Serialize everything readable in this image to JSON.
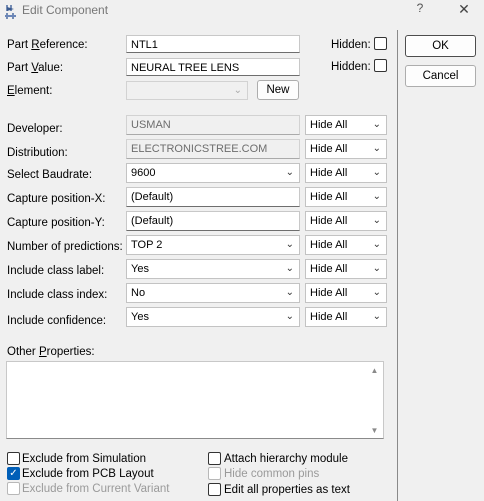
{
  "window": {
    "title": "Edit Component",
    "help_glyph": "?",
    "close_glyph": "✕"
  },
  "part_reference": {
    "label_pre": "Part ",
    "label_u": "R",
    "label_post": "eference:",
    "value": "NTL1",
    "hidden_label": "Hidden:",
    "hidden_checked": false
  },
  "part_value": {
    "label_pre": "Part ",
    "label_u": "V",
    "label_post": "alue:",
    "value": "NEURAL TREE LENS",
    "hidden_label": "Hidden:",
    "hidden_checked": false
  },
  "element": {
    "label_u": "E",
    "label_post": "lement:",
    "value": "",
    "new_button": "New"
  },
  "properties": [
    {
      "label": "Developer:",
      "value": "USMAN",
      "kind": "text-disabled",
      "visibility": "Hide All"
    },
    {
      "label": "Distribution:",
      "value": "ELECTRONICSTREE.COM",
      "kind": "text-disabled",
      "visibility": "Hide All"
    },
    {
      "label": "Select Baudrate:",
      "value": "9600",
      "kind": "combo",
      "visibility": "Hide All"
    },
    {
      "label": "Capture position-X:",
      "value": "(Default)",
      "kind": "text",
      "visibility": "Hide All"
    },
    {
      "label": "Capture position-Y:",
      "value": "(Default)",
      "kind": "text",
      "visibility": "Hide All"
    },
    {
      "label": "Number of predictions:",
      "value": "TOP 2",
      "kind": "combo",
      "visibility": "Hide All"
    },
    {
      "label": "Include class label:",
      "value": "Yes",
      "kind": "combo",
      "visibility": "Hide All"
    },
    {
      "label": "Include class index:",
      "value": "No",
      "kind": "combo",
      "visibility": "Hide All"
    },
    {
      "label": "Include confidence:",
      "value": "Yes",
      "kind": "combo",
      "visibility": "Hide All"
    }
  ],
  "other_properties": {
    "label_pre": "Other ",
    "label_u": "P",
    "label_post": "roperties:",
    "text": ""
  },
  "options": {
    "exclude_simulation": {
      "label": "Exclude from Simulation",
      "checked": false,
      "enabled": true
    },
    "exclude_pcb": {
      "label": "Exclude from PCB Layout",
      "checked": true,
      "enabled": true
    },
    "exclude_variant": {
      "label": "Exclude from Current Variant",
      "checked": false,
      "enabled": false
    },
    "attach_hierarchy": {
      "label": "Attach hierarchy module",
      "checked": false,
      "enabled": true
    },
    "hide_common_pins": {
      "label": "Hide common pins",
      "checked": false,
      "enabled": false
    },
    "edit_all_text": {
      "label": "Edit all properties as text",
      "checked": false,
      "enabled": true
    }
  },
  "buttons": {
    "ok": "OK",
    "cancel": "Cancel"
  },
  "colors": {
    "accent": "#005fb8",
    "background": "#f0f0f0",
    "disabled_text": "#6d6d6d"
  },
  "icons": {
    "combo_arrow": "chevron-down-icon",
    "scroll_up": "triangle-up-icon",
    "scroll_down": "triangle-down-icon"
  }
}
